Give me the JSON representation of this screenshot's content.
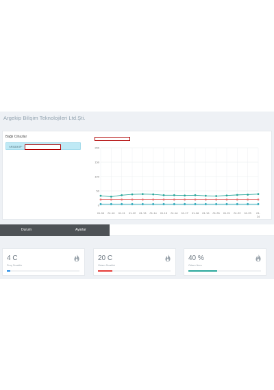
{
  "header": {
    "company": "Argekip Bilişim Teknolojileri Ltd.Şti."
  },
  "devices": {
    "title": "Bağlı Cihazlar",
    "items": [
      {
        "label": "ARGEKIP -"
      }
    ]
  },
  "chart_data": {
    "type": "line",
    "x": [
      "01-09",
      "01-10",
      "01-11",
      "01-12",
      "01-13",
      "01-14",
      "01-15",
      "01-16",
      "01-17",
      "01-18",
      "01-19",
      "01-20",
      "01-21",
      "01-22",
      "01-23",
      "01-24"
    ],
    "x_tick_labels": [
      "01-09",
      "01-10",
      "01-11",
      "01-12",
      "01-13",
      "01-14",
      "01-15",
      "01-16",
      "01-17",
      "01-18",
      "01-19",
      "01-20",
      "01-21",
      "01-22",
      "01-23",
      "01-\n24"
    ],
    "yticks": [
      0,
      50,
      100,
      150,
      200
    ],
    "ylim": [
      0,
      200
    ],
    "grid": true,
    "series": [
      {
        "color": "#26a69a",
        "values": [
          33,
          30,
          35,
          38,
          39,
          38,
          35,
          35,
          34,
          35,
          33,
          32,
          34,
          36,
          37,
          39
        ]
      },
      {
        "color": "#e57373",
        "values": [
          20,
          20,
          20,
          20,
          20,
          20,
          20,
          20,
          20,
          20,
          20,
          20,
          20,
          20,
          20,
          20
        ]
      },
      {
        "color": "#26a6b8",
        "values": [
          4,
          4,
          4,
          4,
          4,
          4,
          4,
          4,
          4,
          4,
          4,
          4,
          4,
          4,
          4,
          4
        ]
      }
    ]
  },
  "tabs": [
    {
      "label": "Durum"
    },
    {
      "label": "Ayarlar"
    }
  ],
  "stats": [
    {
      "value": "4 C",
      "label": "Proç Sıcaklık",
      "fill": 0.05,
      "color": "#1e88e5"
    },
    {
      "value": "20 C",
      "label": "Ortam Sıcaklık",
      "fill": 0.2,
      "color": "#e53935"
    },
    {
      "value": "40 %",
      "label": "Ortam Nem",
      "fill": 0.4,
      "color": "#26a69a"
    }
  ]
}
